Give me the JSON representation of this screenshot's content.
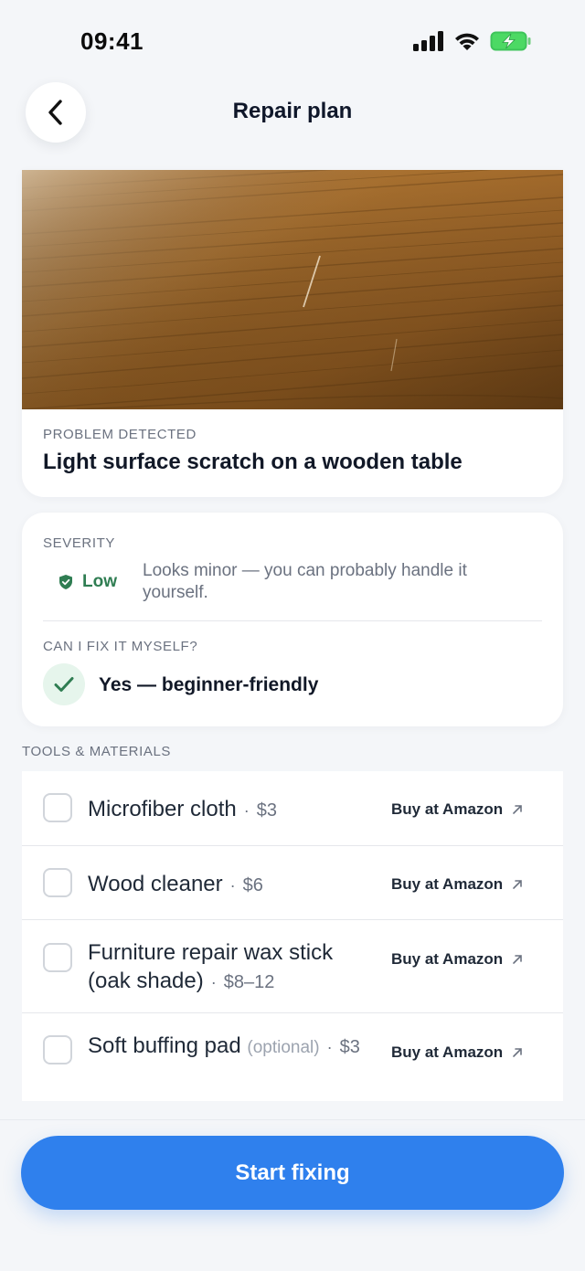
{
  "status_bar": {
    "time": "09:41",
    "icons": [
      "signal-icon",
      "wifi-icon",
      "battery-charging-icon"
    ]
  },
  "nav": {
    "title": "Repair plan",
    "back_icon": "chevron-left-icon"
  },
  "problem": {
    "label": "PROBLEM DETECTED",
    "text": "Light surface scratch on a wooden table",
    "photo": "wooden-table-scratch-photo"
  },
  "severity": {
    "label": "SEVERITY",
    "level": "Low",
    "description": "Looks minor — you can probably handle it yourself.",
    "icon": "shield-check-icon",
    "color": "#2f7d52"
  },
  "diy": {
    "label": "CAN I FIX IT MYSELF?",
    "answer": "Yes — beginner-friendly",
    "icon": "checkmark-icon"
  },
  "tools": {
    "label": "TOOLS & MATERIALS",
    "items": [
      {
        "name": "Microfiber cloth",
        "note": "",
        "price": "$3",
        "link": "Buy at Amazon",
        "checked": false
      },
      {
        "name": "Wood cleaner",
        "note": "",
        "price": "$6",
        "link": "Buy at Amazon",
        "checked": false
      },
      {
        "name": "Furniture repair wax stick (oak shade)",
        "note": "",
        "price": "$8–12",
        "link": "Buy at Amazon",
        "checked": false
      },
      {
        "name": "Soft buffing pad",
        "note": "(optional)",
        "price": "$3",
        "link": "Buy at Amazon",
        "checked": false
      }
    ]
  },
  "cta": {
    "label": "Start fixing",
    "color": "#2f80ed"
  }
}
